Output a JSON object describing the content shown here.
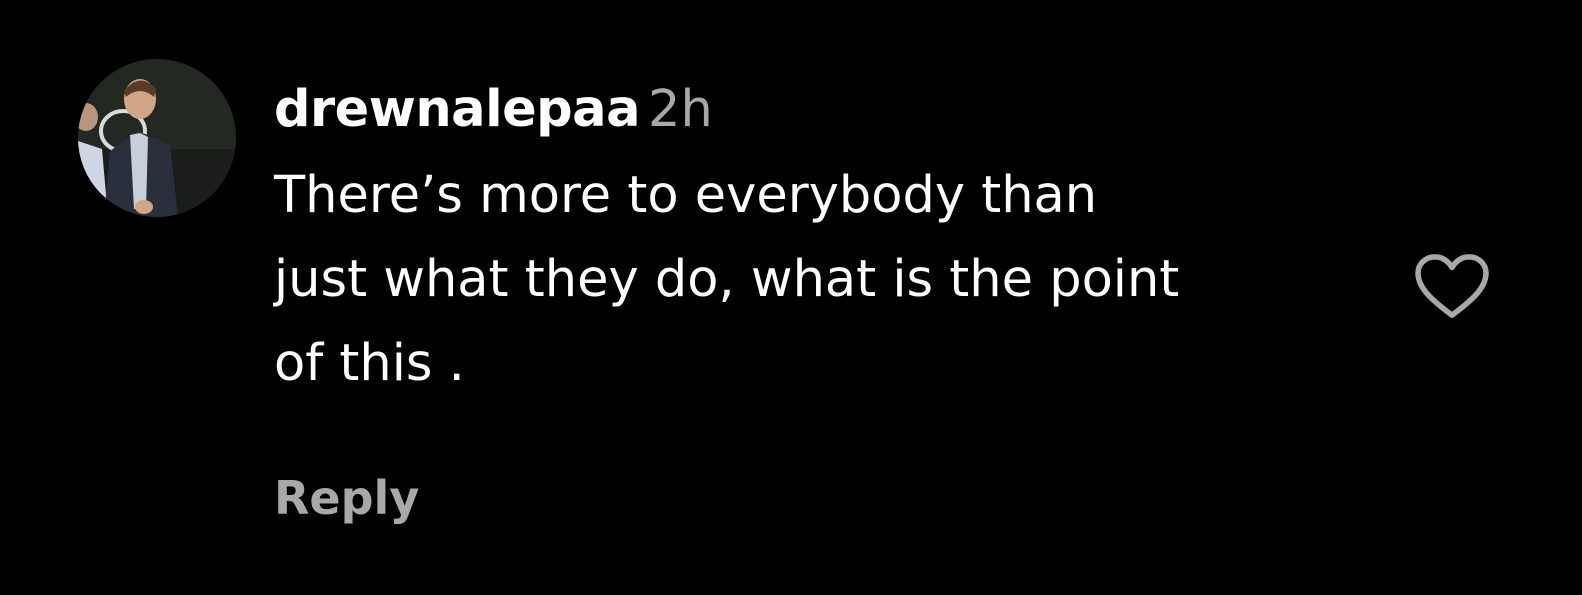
{
  "comment": {
    "username": "drewnalepaa",
    "timestamp": "2h",
    "text_lines": [
      "There’s more to everybody than",
      "just what they do, what is the point",
      "of this ."
    ],
    "reply_label": "Reply",
    "avatar_icon": "profile-photo",
    "like_icon": "heart-outline-icon"
  },
  "colors": {
    "background": "#000000",
    "text_primary": "#ffffff",
    "text_secondary": "#a8a8a8"
  }
}
